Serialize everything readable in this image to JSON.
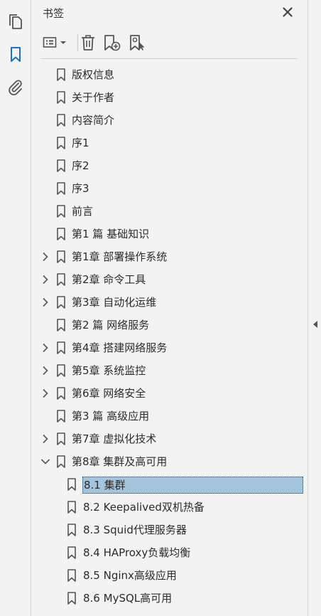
{
  "rail": {
    "items": [
      {
        "name": "pages-icon"
      },
      {
        "name": "bookmarks-icon",
        "active": true
      },
      {
        "name": "attachments-icon"
      }
    ]
  },
  "panel": {
    "title": "书签",
    "toolbar": [
      "options-menu-icon",
      "delete-icon",
      "new-bookmark-icon",
      "bookmark-settings-icon"
    ]
  },
  "bookmarks": [
    {
      "label": "版权信息",
      "level": 1,
      "expand": "none"
    },
    {
      "label": "关于作者",
      "level": 1,
      "expand": "none"
    },
    {
      "label": "内容简介",
      "level": 1,
      "expand": "none"
    },
    {
      "label": "序1",
      "level": 1,
      "expand": "none"
    },
    {
      "label": "序2",
      "level": 1,
      "expand": "none"
    },
    {
      "label": "序3",
      "level": 1,
      "expand": "none"
    },
    {
      "label": "前言",
      "level": 1,
      "expand": "none"
    },
    {
      "label": "第1 篇 基础知识",
      "level": 1,
      "expand": "none"
    },
    {
      "label": "第1章 部署操作系统",
      "level": 1,
      "expand": "collapsed"
    },
    {
      "label": "第2章 命令工具",
      "level": 1,
      "expand": "collapsed"
    },
    {
      "label": "第3章 自动化运维",
      "level": 1,
      "expand": "collapsed"
    },
    {
      "label": "第2 篇 网络服务",
      "level": 1,
      "expand": "none"
    },
    {
      "label": "第4章 搭建网络服务",
      "level": 1,
      "expand": "collapsed"
    },
    {
      "label": "第5章 系统监控",
      "level": 1,
      "expand": "collapsed"
    },
    {
      "label": "第6章 网络安全",
      "level": 1,
      "expand": "collapsed"
    },
    {
      "label": "第3 篇 高级应用",
      "level": 1,
      "expand": "none"
    },
    {
      "label": "第7章 虚拟化技术",
      "level": 1,
      "expand": "collapsed"
    },
    {
      "label": "第8章 集群及高可用",
      "level": 1,
      "expand": "expanded"
    },
    {
      "label": "8.1 集群",
      "level": 2,
      "expand": "none",
      "selected": true
    },
    {
      "label": "8.2 Keepalived双机热备",
      "level": 2,
      "expand": "none"
    },
    {
      "label": "8.3 Squid代理服务器",
      "level": 2,
      "expand": "none"
    },
    {
      "label": "8.4 HAProxy负载均衡",
      "level": 2,
      "expand": "none"
    },
    {
      "label": "8.5 Nginx高级应用",
      "level": 2,
      "expand": "none"
    },
    {
      "label": "8.6 MySQL高可用",
      "level": 2,
      "expand": "none"
    }
  ],
  "colors": {
    "background": "#f3f3f3",
    "selection": "#a4c4dc",
    "active_icon": "#1a73c9"
  }
}
